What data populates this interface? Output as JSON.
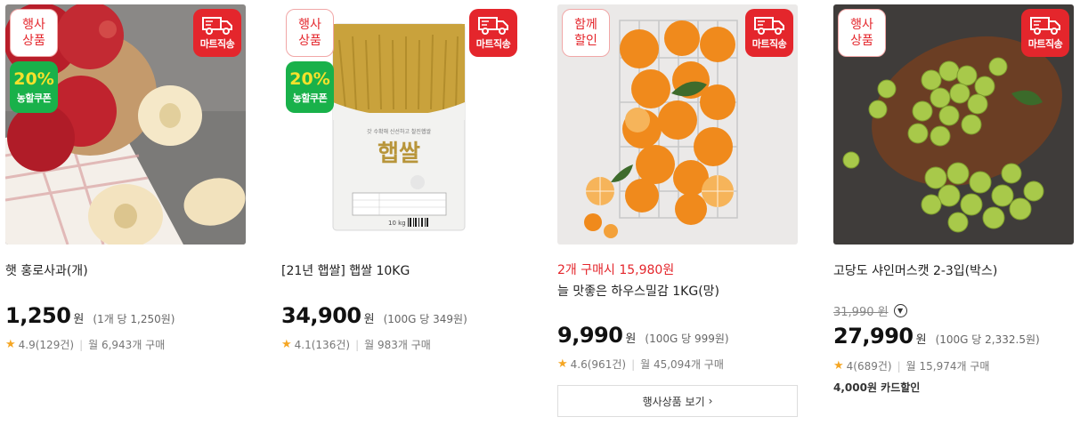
{
  "badges": {
    "event": "행사\n상품",
    "together": "함께\n할인",
    "mart": "마트직송",
    "coupon_pct": "20%",
    "coupon_label": "농할쿠폰"
  },
  "icons": {
    "truck": "truck-icon",
    "star": "star-icon",
    "chevron": "chevron-right-icon",
    "info": "chevron-down-circle-icon"
  },
  "colors": {
    "accent_red": "#e4262c",
    "coupon_green": "#19b14a",
    "coupon_yellow": "#f5e12c",
    "star": "#f5a623"
  },
  "products": [
    {
      "name": "햇 홍로사과(개)",
      "price": "1,250",
      "currency": "원",
      "unit_price": "(1개 당 1,250원)",
      "rating": "4.9(129건)",
      "monthly": "월 6,943개 구매",
      "badge_left": "event",
      "has_coupon": true
    },
    {
      "name": "[21년 햅쌀] 햅쌀 10KG",
      "price": "34,900",
      "currency": "원",
      "unit_price": "(100G 당 349원)",
      "rating": "4.1(136건)",
      "monthly": "월 983개 구매",
      "badge_left": "event",
      "has_coupon": true,
      "package": {
        "top_text": "갓 수확해 신선하고 찰진햅쌀",
        "title": "햅쌀",
        "weight": "10 kg"
      }
    },
    {
      "promo": "2개 구매시 15,980원",
      "name": "늘 맛좋은 하우스밀감 1KG(망)",
      "price": "9,990",
      "currency": "원",
      "unit_price": "(100G 당 999원)",
      "rating": "4.6(961건)",
      "monthly": "월 45,094개 구매",
      "badge_left": "together",
      "button": "행사상품 보기"
    },
    {
      "name": "고당도 샤인머스캣 2-3입(박스)",
      "original_price": "31,990 원",
      "price": "27,990",
      "currency": "원",
      "unit_price": "(100G 당 2,332.5원)",
      "rating": "4(689건)",
      "monthly": "월 15,974개 구매",
      "card_discount": "4,000원 카드할인",
      "badge_left": "event"
    }
  ]
}
